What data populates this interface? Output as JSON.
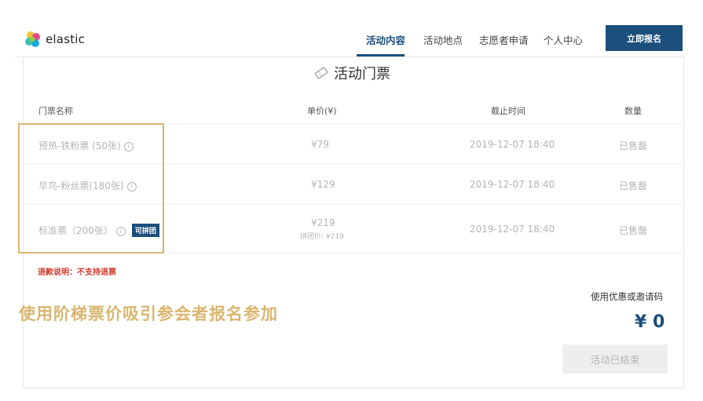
{
  "nav": {
    "logo_text": "elastic",
    "links": [
      "活动内容",
      "活动地点",
      "志愿者申请",
      "个人中心"
    ],
    "cta": "立即报名"
  },
  "section": {
    "title": "活动门票"
  },
  "table": {
    "headers": [
      "门票名称",
      "单价(¥)",
      "截止时间",
      "数量"
    ],
    "rows": [
      {
        "name": "预热-铁粉票 (50张)",
        "price": "¥79",
        "deadline": "2019-12-07 18:40",
        "status": "已售罄"
      },
      {
        "name": "早鸟-粉丝票(180张)",
        "price": "¥129",
        "deadline": "2019-12-07 18:40",
        "status": "已售罄"
      },
      {
        "name": "标准票（200张）",
        "badge": "可拼团",
        "price": "¥219",
        "group_price": "拼团价: ¥219",
        "deadline": "2019-12-07 18:40",
        "status": "已售罄"
      }
    ]
  },
  "refund_note": "退款说明：不支持退票",
  "promo_caption": "使用阶梯票价吸引参会者报名参加",
  "coupon_link": "使用优惠或邀请码",
  "total": "¥ 0",
  "ended_button": "活动已结束",
  "colors": {
    "brand": "#1b4f7c",
    "highlight": "#d9b670",
    "warning": "#d03a2a"
  }
}
